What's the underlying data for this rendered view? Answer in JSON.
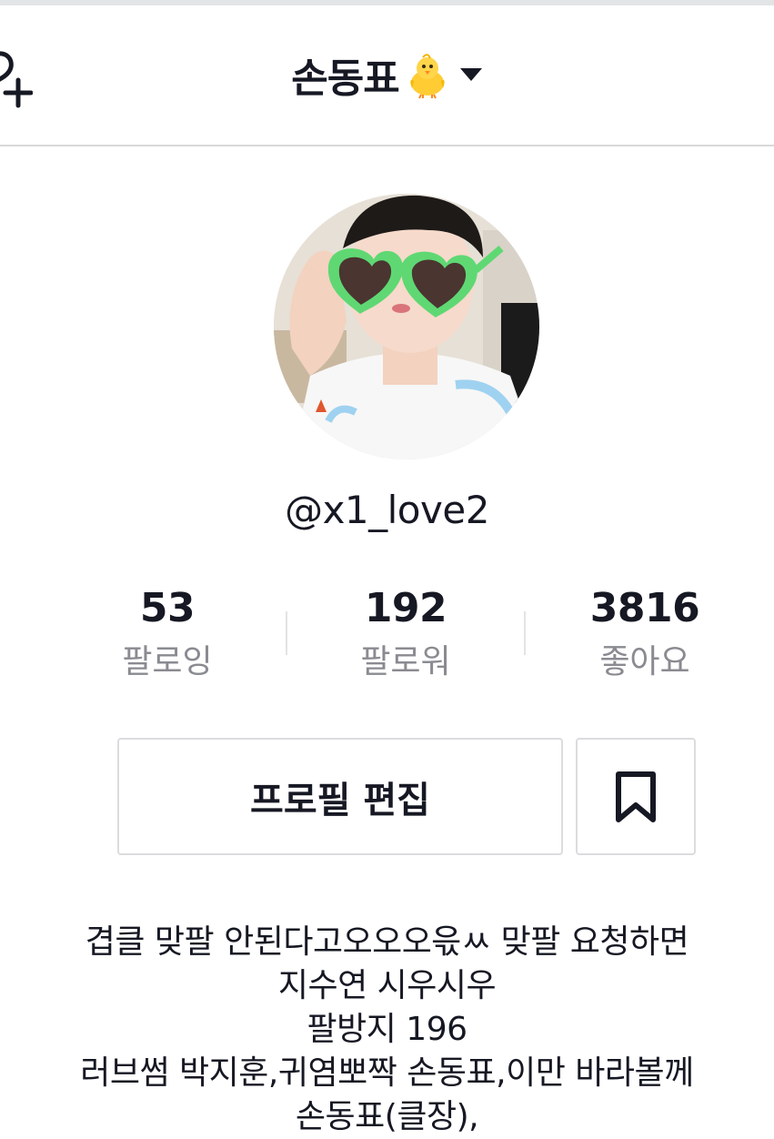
{
  "header": {
    "title": "손동표",
    "title_emoji_icon": "baby-chick-icon",
    "add_user_icon": "add-user-icon",
    "dropdown_icon": "caret-down-icon"
  },
  "profile": {
    "avatar_icon": "profile-photo",
    "username": "@x1_love2"
  },
  "stats": [
    {
      "value": "53",
      "label": "팔로잉"
    },
    {
      "value": "192",
      "label": "팔로워"
    },
    {
      "value": "3816",
      "label": "좋아요"
    }
  ],
  "actions": {
    "edit_profile_label": "프로필 편집",
    "bookmark_icon": "bookmark-icon"
  },
  "bio": {
    "lines": [
      "겹클 맞팔 안된다고오오오윿ㅆ 맞팔 요청하면",
      "지수연 시우시우",
      "팔방지 196",
      "러브썸 박지훈,귀염뽀짝 손동표,이만 바라볼께",
      "손동표(클장),"
    ]
  },
  "colors": {
    "text_primary": "#161823",
    "text_secondary": "#8a8b91",
    "border": "#dcdcdf"
  }
}
